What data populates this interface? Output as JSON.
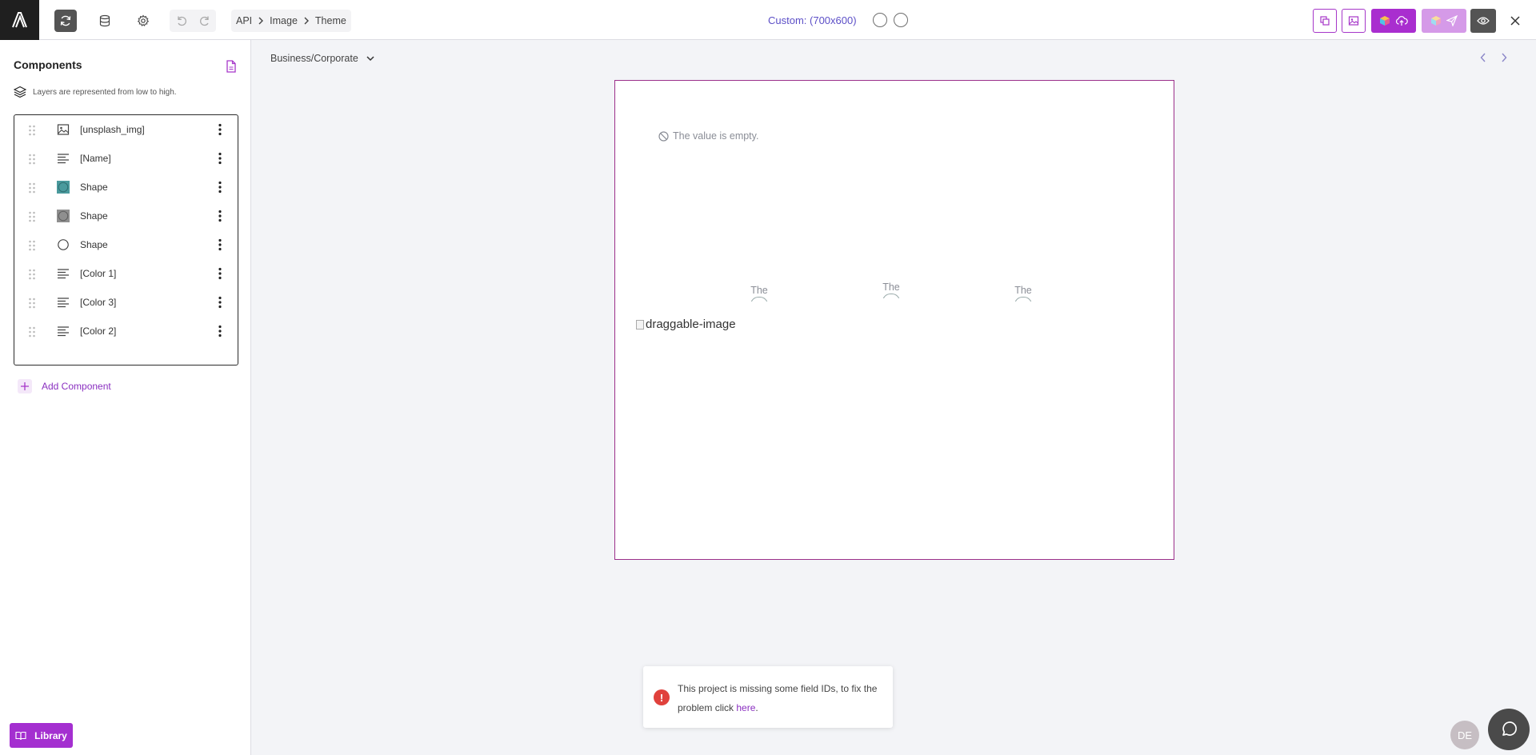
{
  "topbar": {
    "breadcrumb": [
      "API",
      "Image",
      "Theme"
    ],
    "size_label": "Custom: (700x600)"
  },
  "sidebar": {
    "title": "Components",
    "hint": "Layers are represented from low to high.",
    "layers": [
      {
        "label": "[unsplash_img]",
        "icon": "image-icon"
      },
      {
        "label": "[Name]",
        "icon": "text-icon"
      },
      {
        "label": "Shape",
        "icon": "teal-circle-shape-icon",
        "color": "#4a9a9d"
      },
      {
        "label": "Shape",
        "icon": "gray-circle-shape-icon",
        "color": "#8f8f8f"
      },
      {
        "label": "Shape",
        "icon": "circle-outline-icon"
      },
      {
        "label": "[Color 1]",
        "icon": "text-icon"
      },
      {
        "label": "[Color 3]",
        "icon": "text-icon"
      },
      {
        "label": "[Color 2]",
        "icon": "text-icon"
      }
    ],
    "add_component": "Add Component",
    "library": "Library"
  },
  "main": {
    "category": "Business/Corporate",
    "canvas": {
      "empty_value": "The value is empty.",
      "cut_texts": [
        "The",
        "The",
        "The"
      ],
      "image_alt": "draggable-image"
    }
  },
  "toast": {
    "message": "This project is missing some field IDs, to fix the problem click ",
    "link": "here",
    "suffix": "."
  },
  "avatar": "DE",
  "colors": {
    "accent": "#a42fd0",
    "canvas_border": "#9b2f8a",
    "size_label": "#5c4fc7"
  }
}
